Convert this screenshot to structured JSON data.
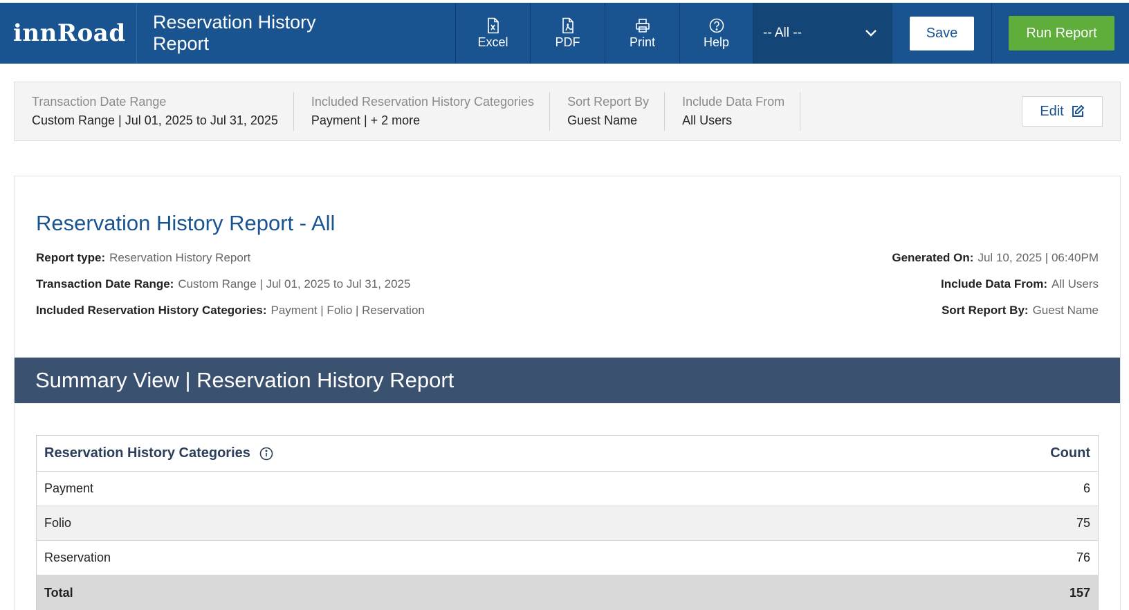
{
  "header": {
    "brand": "innRoad",
    "title_line1": "Reservation History",
    "title_line2": "Report",
    "tools": [
      {
        "label": "Excel",
        "icon": "excel-file-icon"
      },
      {
        "label": "PDF",
        "icon": "pdf-file-icon"
      },
      {
        "label": "Print",
        "icon": "printer-icon"
      },
      {
        "label": "Help",
        "icon": "help-circle-icon"
      }
    ],
    "filter_select": {
      "value": "-- All --",
      "icon": "chevron-down-icon"
    },
    "save_label": "Save",
    "run_label": "Run Report",
    "colors": {
      "bar": "#1a5490",
      "run": "#5fad3a"
    }
  },
  "filters": [
    {
      "label": "Transaction Date Range",
      "value": "Custom Range | Jul 01, 2025 to Jul 31, 2025"
    },
    {
      "label": "Included Reservation History Categories",
      "value": "Payment | + 2 more"
    },
    {
      "label": "Sort Report By",
      "value": "Guest Name"
    },
    {
      "label": "Include Data From",
      "value": "All Users"
    }
  ],
  "edit_label": "Edit",
  "report": {
    "title": "Reservation History Report - All",
    "meta_left": [
      {
        "label": "Report type:",
        "value": "Reservation History Report"
      },
      {
        "label": "Transaction Date Range:",
        "value": "Custom Range | Jul 01, 2025 to Jul 31, 2025"
      },
      {
        "label": "Included Reservation History Categories:",
        "value": "Payment | Folio | Reservation"
      }
    ],
    "meta_right": [
      {
        "label": "Generated On:",
        "value": "Jul 10, 2025 | 06:40PM"
      },
      {
        "label": "Include Data From:",
        "value": "All Users"
      },
      {
        "label": "Sort Report By:",
        "value": "Guest Name"
      }
    ],
    "summary_title": "Summary View | Reservation History Report",
    "table": {
      "headers": [
        "Reservation History Categories",
        "Count"
      ],
      "rows": [
        {
          "category": "Payment",
          "count": "6"
        },
        {
          "category": "Folio",
          "count": "75"
        },
        {
          "category": "Reservation",
          "count": "76"
        }
      ],
      "total": {
        "label": "Total",
        "count": "157"
      }
    }
  }
}
